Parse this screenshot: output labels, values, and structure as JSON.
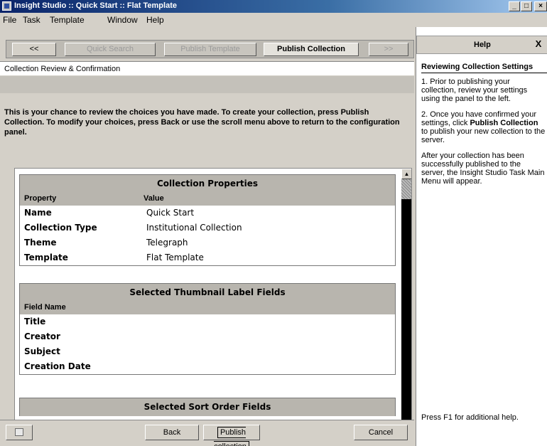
{
  "window": {
    "title": "Insight Studio :: Quick Start :: Flat Template",
    "minimize": "_",
    "maximize": "□",
    "close": "×"
  },
  "menu": [
    {
      "label": "File"
    },
    {
      "label": "Task"
    },
    {
      "label": "Template"
    },
    {
      "label": "Window"
    },
    {
      "label": "Help"
    }
  ],
  "nav": {
    "back": "<<",
    "quick_search": "Quick Search",
    "publish_template": "Publish Template",
    "publish_collection": "Publish Collection",
    "forward": ">>"
  },
  "main": {
    "section_title": "Collection Review & Confirmation",
    "intro": "This is your chance to review the choices you have made.  To create your collection, press Publish Collection.  To modify your choices, press Back or use the scroll menu above to return to the configuration panel."
  },
  "properties_table": {
    "title": "Collection Properties",
    "col1": "Property",
    "col2": "Value",
    "rows": [
      {
        "k": "Name",
        "v": "Quick Start"
      },
      {
        "k": "Collection Type",
        "v": "Institutional Collection"
      },
      {
        "k": "Theme",
        "v": "Telegraph"
      },
      {
        "k": "Template",
        "v": "Flat Template"
      }
    ]
  },
  "thumbnail_table": {
    "title": "Selected Thumbnail Label Fields",
    "col1": "Field Name",
    "rows": [
      "Title",
      "Creator",
      "Subject",
      "Creation Date"
    ]
  },
  "sort_table": {
    "title": "Selected Sort Order Fields"
  },
  "footer": {
    "back": "Back",
    "publish": "Publish collection",
    "cancel": "Cancel"
  },
  "help": {
    "title": "Help",
    "close": "X",
    "subhead": "Reviewing Collection Settings",
    "p1": "1. Prior to publishing your collection, review your settings using the panel to the left.",
    "p2_pre": "2. Once you have confirmed your settings, click ",
    "p2_bold": "Publish Collection",
    "p2_post": " to publish your new collection to the server.",
    "p3": "After your collection has been successfully published to the server, the Insight Studio Task Main Menu will appear.",
    "footer": "Press F1 for additional help."
  }
}
